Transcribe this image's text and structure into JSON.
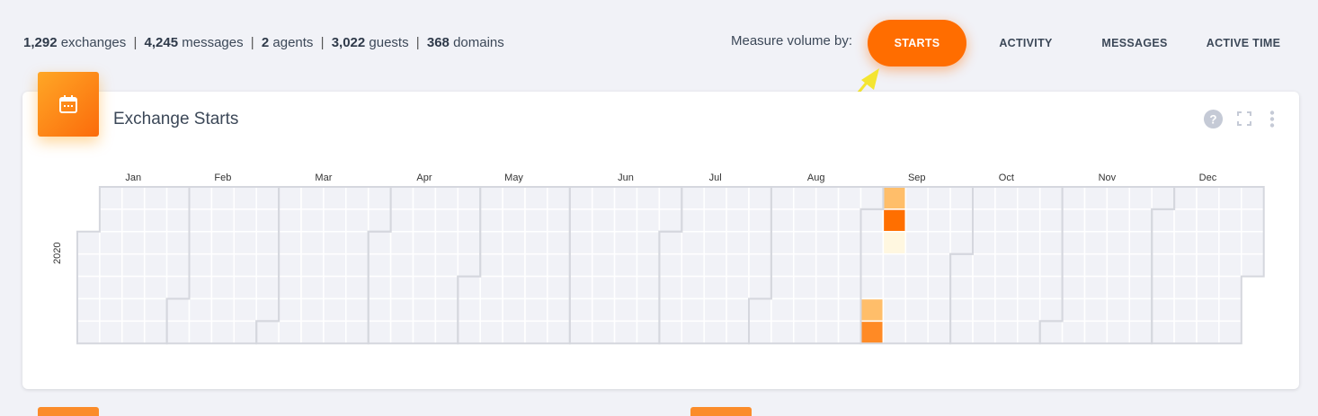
{
  "stats": {
    "exchanges": {
      "value": "1,292",
      "label": "exchanges"
    },
    "messages": {
      "value": "4,245",
      "label": "messages"
    },
    "agents": {
      "value": "2",
      "label": "agents"
    },
    "guests": {
      "value": "3,022",
      "label": "guests"
    },
    "domains": {
      "value": "368",
      "label": "domains"
    }
  },
  "measure": {
    "label": "Measure volume by:",
    "options": [
      {
        "label": "STARTS",
        "active": true
      },
      {
        "label": "ACTIVITY",
        "active": false
      },
      {
        "label": "MESSAGES",
        "active": false
      },
      {
        "label": "ACTIVE TIME",
        "active": false
      }
    ]
  },
  "card": {
    "title": "Exchange Starts",
    "icon": "calendar-icon",
    "tools": [
      "help-icon",
      "fullscreen-icon",
      "more-vert-icon"
    ]
  },
  "calendar": {
    "year": "2020",
    "months": [
      "Jan",
      "Feb",
      "Mar",
      "Apr",
      "May",
      "Jun",
      "Jul",
      "Aug",
      "Sep",
      "Oct",
      "Nov",
      "Dec"
    ],
    "filled_cells": [
      {
        "date": "2020-09-05",
        "level": 3
      },
      {
        "date": "2020-09-06",
        "level": 4
      },
      {
        "date": "2020-09-07",
        "level": 3
      },
      {
        "date": "2020-09-08",
        "level": 5
      },
      {
        "date": "2020-09-09",
        "level": 1
      }
    ],
    "colors": {
      "empty": "#f1f2f7",
      "border": "#ffffff",
      "month_outline": "#d5d7de",
      "level1": "#fff7e0",
      "level2": "#ffd08a",
      "level3": "#ffbe6a",
      "level4": "#ff8a25",
      "level5": "#ff6f00"
    }
  },
  "colors": {
    "accent": "#ff6d00",
    "background": "#f1f2f7",
    "annotation_arrow": "#f4e532"
  }
}
